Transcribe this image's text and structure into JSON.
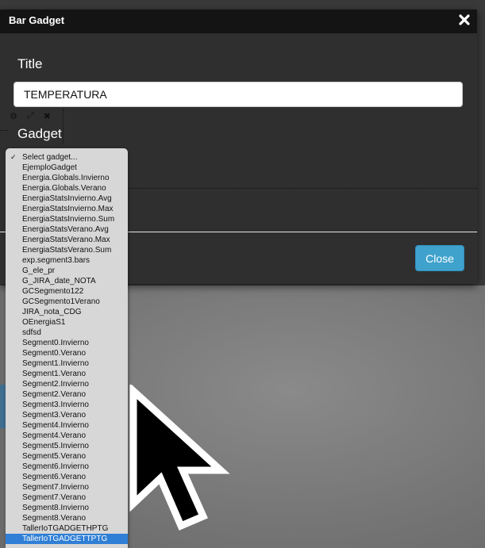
{
  "dialog": {
    "title": "Bar Gadget",
    "title_label": "Title",
    "title_value": "TEMPERATURA",
    "gadget_label": "Gadget",
    "close_label": "Close"
  },
  "gadget_select": {
    "placeholder": "Select gadget...",
    "selected": "TallerIoTGADGETTPTG",
    "options": [
      "EjemploGadget",
      "Energia.Globals.Invierno",
      "Energia.Globals.Verano",
      "EnergiaStatsInvierno.Avg",
      "EnergiaStatsInvierno.Max",
      "EnergiaStatsInvierno.Sum",
      "EnergiaStatsVerano.Avg",
      "EnergiaStatsVerano.Max",
      "EnergiaStatsVerano.Sum",
      "exp.segment3.bars",
      "G_ele_pr",
      "G_JIRA_date_NOTA",
      "GCSegmento122",
      "GCSegmento1Verano",
      "JIRA_nota_CDG",
      "OEnergiaS1",
      "sdfsd",
      "Segment0.Invierno",
      "Segment0.Verano",
      "Segment1.Invierno",
      "Segment1.Verano",
      "Segment2.Invierno",
      "Segment2.Verano",
      "Segment3.Invierno",
      "Segment3.Verano",
      "Segment4.Invierno",
      "Segment4.Verano",
      "Segment5.Invierno",
      "Segment5.Verano",
      "Segment6.Invierno",
      "Segment6.Verano",
      "Segment7.Invierno",
      "Segment7.Verano",
      "Segment8.Invierno",
      "Segment8.Verano",
      "TallerIoTGADGETHPTG",
      "TallerIoTGADGETTPTG"
    ]
  },
  "icons": {
    "close": "close-icon",
    "check": "checkmark-icon",
    "cursor": "mouse-pointer-icon"
  },
  "colors": {
    "accent": "#3fa2cc",
    "selection": "#2f7fd6",
    "header": "#141414",
    "modal": "#2f2f2f"
  }
}
